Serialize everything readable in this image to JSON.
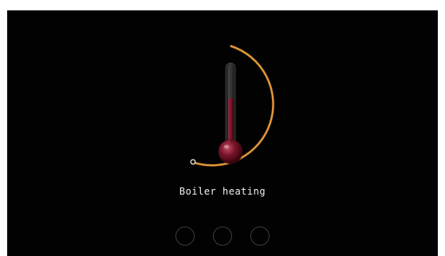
{
  "status": {
    "label": "Boiler heating"
  },
  "progress": {
    "fraction": 0.5,
    "arc_color": "#e39a3c",
    "thermometer_fill_color": "#7a1428"
  },
  "page_indicators": {
    "count": 3,
    "active_index": -1
  },
  "colors": {
    "background": "#020202",
    "text": "#f2f2f2"
  },
  "icons": [
    "thermometer-icon"
  ]
}
